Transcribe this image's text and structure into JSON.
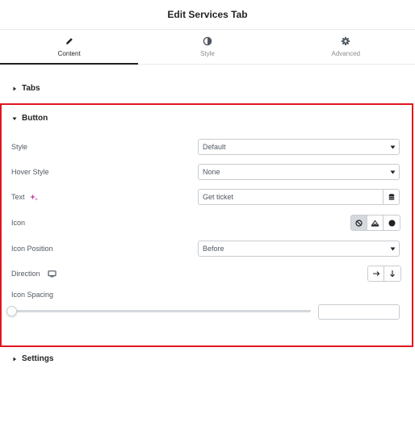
{
  "panel": {
    "title": "Edit Services Tab"
  },
  "tabs": [
    {
      "label": "Content",
      "icon": "pencil-icon",
      "active": true
    },
    {
      "label": "Style",
      "icon": "half-circle-icon",
      "active": false
    },
    {
      "label": "Advanced",
      "icon": "gear-icon",
      "active": false
    }
  ],
  "sections": {
    "tabs": {
      "label": "Tabs",
      "expanded": false
    },
    "button": {
      "label": "Button",
      "expanded": true
    },
    "settings": {
      "label": "Settings",
      "expanded": false
    }
  },
  "button": {
    "style": {
      "label": "Style",
      "value": "Default"
    },
    "hover_style": {
      "label": "Hover Style",
      "value": "None"
    },
    "text": {
      "label": "Text",
      "value": "Get ticket",
      "ai_icon": "ai-sparkle-icon",
      "dynamic_icon": "database-icon"
    },
    "icon": {
      "label": "Icon",
      "options": [
        "none-icon",
        "upload-icon",
        "circle-icon"
      ],
      "selected": "none-icon"
    },
    "icon_position": {
      "label": "Icon Position",
      "value": "Before"
    },
    "direction": {
      "label": "Direction",
      "responsive_icon": "desktop-icon",
      "options": [
        "arrow-right-icon",
        "arrow-down-icon"
      ]
    },
    "icon_spacing": {
      "label": "Icon Spacing",
      "value": ""
    }
  },
  "colors": {
    "highlight": "#e0161f",
    "text": "#515962",
    "heading": "#1f2124"
  }
}
